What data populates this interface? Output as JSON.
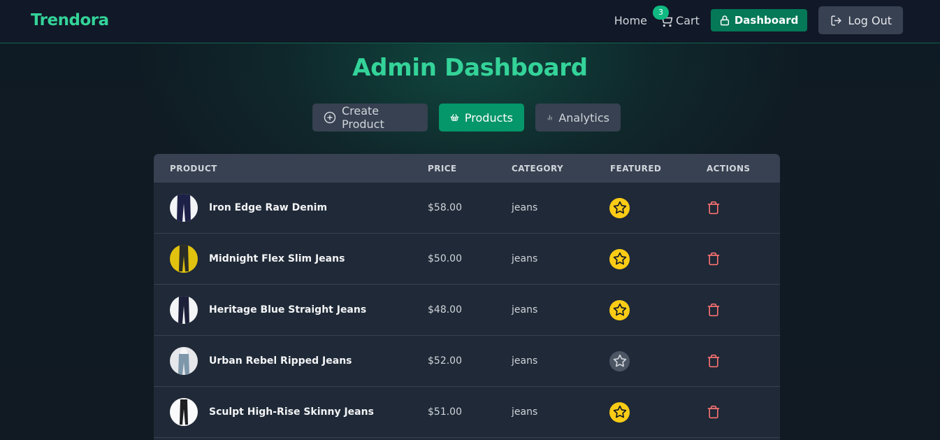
{
  "navbar": {
    "brand": "Trendora",
    "home_label": "Home",
    "cart_label": "Cart",
    "cart_count": "3",
    "dashboard_label": "Dashboard",
    "logout_label": "Log Out",
    "accent_color": "#34d399"
  },
  "page": {
    "title": "Admin Dashboard"
  },
  "tabs": [
    {
      "label": "Create Product",
      "icon": "plus-circle-icon",
      "active": false
    },
    {
      "label": "Products",
      "icon": "shopping-basket-icon",
      "active": true
    },
    {
      "label": "Analytics",
      "icon": "bar-chart-icon",
      "active": false
    }
  ],
  "table": {
    "columns": [
      "PRODUCT",
      "PRICE",
      "CATEGORY",
      "FEATURED",
      "ACTIONS"
    ],
    "rows": [
      {
        "name": "Iron Edge Raw Denim",
        "price": "$58.00",
        "category": "jeans",
        "featured": true
      },
      {
        "name": "Midnight Flex Slim Jeans",
        "price": "$50.00",
        "category": "jeans",
        "featured": true
      },
      {
        "name": "Heritage Blue Straight Jeans",
        "price": "$48.00",
        "category": "jeans",
        "featured": true
      },
      {
        "name": "Urban Rebel Ripped Jeans",
        "price": "$52.00",
        "category": "jeans",
        "featured": false
      },
      {
        "name": "Sculpt High-Rise Skinny Jeans",
        "price": "$51.00",
        "category": "jeans",
        "featured": true
      }
    ]
  },
  "colors": {
    "featured_on": "#facc15",
    "featured_off": "#4b5563",
    "delete": "#f87171",
    "active_tab": "#059669"
  }
}
